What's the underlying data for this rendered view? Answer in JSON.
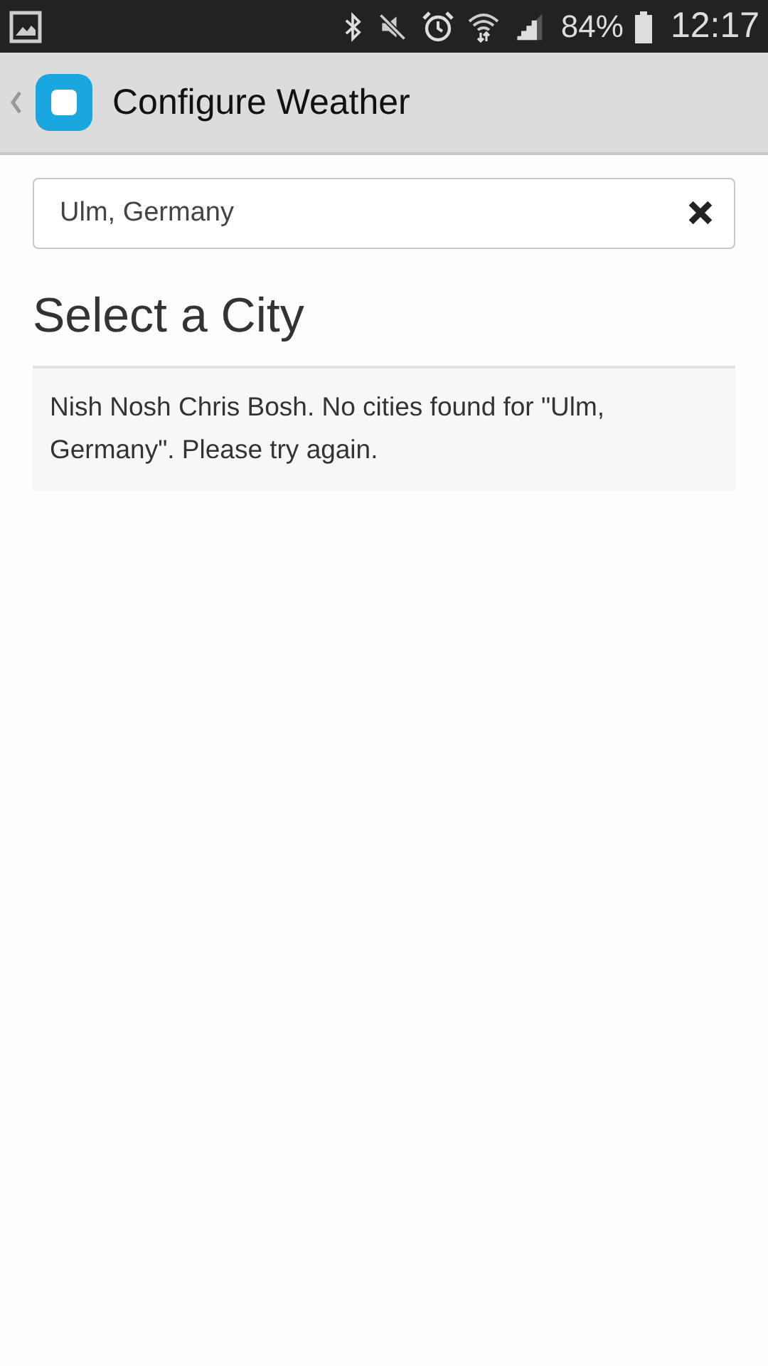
{
  "status_bar": {
    "battery": "84%",
    "time": "12:17"
  },
  "app_bar": {
    "title": "Configure Weather"
  },
  "search": {
    "value": "Ulm, Germany"
  },
  "section": {
    "title": "Select a City"
  },
  "message": "Nish Nosh Chris Bosh. No cities found for \"Ulm, Germany\". Please try again."
}
